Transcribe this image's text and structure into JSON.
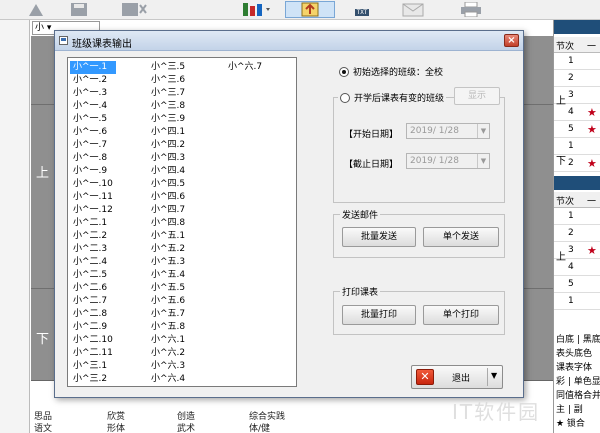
{
  "dialog": {
    "title": "班级课表输出",
    "close_label": "×",
    "class_list_columns": [
      [
        "小^一.1",
        "小^一.2",
        "小^一.3",
        "小^一.4",
        "小^一.5",
        "小^一.6",
        "小^一.7",
        "小^一.8",
        "小^一.9",
        "小^一.10",
        "小^一.11",
        "小^一.12",
        "小^二.1",
        "小^二.2",
        "小^二.3",
        "小^二.4",
        "小^二.5",
        "小^二.6",
        "小^二.7",
        "小^二.8",
        "小^二.9",
        "小^二.10",
        "小^二.11",
        "小^三.1",
        "小^三.2",
        "小^三.3",
        "小^三.4"
      ],
      [
        "小^三.5",
        "小^三.6",
        "小^三.7",
        "小^三.8",
        "小^三.9",
        "小^四.1",
        "小^四.2",
        "小^四.3",
        "小^四.4",
        "小^四.5",
        "小^四.6",
        "小^四.7",
        "小^四.8",
        "小^五.1",
        "小^五.2",
        "小^五.3",
        "小^五.4",
        "小^五.5",
        "小^五.6",
        "小^五.7",
        "小^五.8",
        "小^六.1",
        "小^六.2",
        "小^六.3",
        "小^六.4",
        "小^六.5",
        "小^六.6"
      ],
      [
        "小^六.7"
      ]
    ],
    "selected_class": "小^一.1",
    "radio_initial": "初始选择的班级：全校",
    "radio_changed": "开学后课表有变的班级",
    "show_button": "显示",
    "start_date_label": "【开始日期】",
    "start_date_value": "2019/ 1/28",
    "end_date_label": "【截止日期】",
    "end_date_value": "2019/ 1/28",
    "send_group_label": "发送邮件",
    "batch_send_button": "批量发送",
    "single_send_button": "单个发送",
    "print_group_label": "打印课表",
    "batch_print_button": "批量打印",
    "single_print_button": "单个打印",
    "exit_button": "退出"
  },
  "background": {
    "select_value": "小",
    "side_label_top": "上",
    "side_label_bottom": "下",
    "bottom_rows": [
      [
        "思品",
        "欣赏",
        "创造",
        "综合实践"
      ],
      [
        "语文",
        "形体",
        "武术",
        "体/健"
      ]
    ],
    "right_panel": {
      "header1": [
        "节次",
        "一"
      ],
      "rows1": [
        "1",
        "2",
        "3",
        "4",
        "5",
        "1",
        "2"
      ],
      "group_top": "上",
      "group_bottom": "下",
      "header2": [
        "节次",
        "一"
      ],
      "rows2": [
        "1",
        "2",
        "3",
        "4",
        "5",
        "1"
      ],
      "footer_lines": [
        "白底 | 黑底",
        "表头底色",
        "课表字体",
        "彩 | 单色显",
        "同值格合并",
        "主 | 副",
        "★ 锁合"
      ],
      "star": "★"
    }
  },
  "watermark": "IT软件园"
}
